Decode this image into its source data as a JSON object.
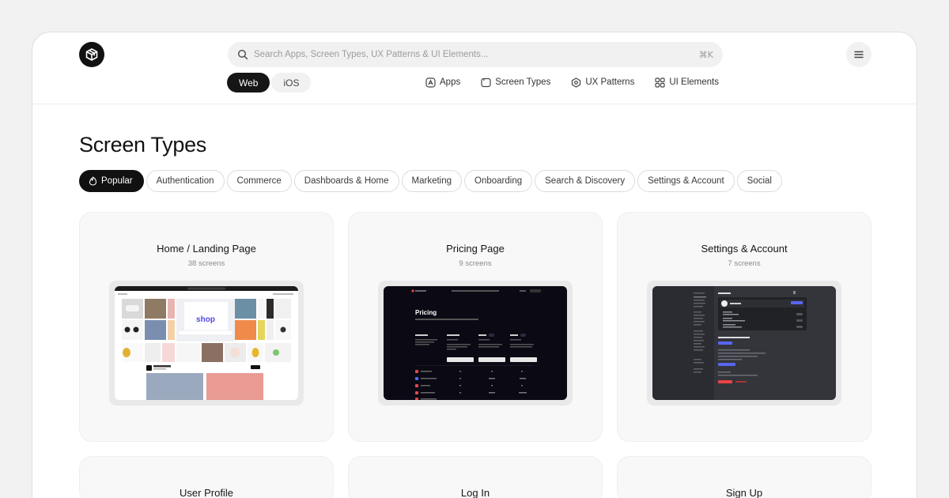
{
  "search": {
    "placeholder": "Search Apps, Screen Types, UX Patterns & UI Elements...",
    "shortcut": "⌘K"
  },
  "platform": {
    "web": "Web",
    "ios": "iOS",
    "selected": "Web"
  },
  "nav": {
    "apps": "Apps",
    "screen_types": "Screen Types",
    "ux_patterns": "UX Patterns",
    "ui_elements": "UI Elements"
  },
  "page": {
    "title": "Screen Types"
  },
  "filters": [
    "Popular",
    "Authentication",
    "Commerce",
    "Dashboards & Home",
    "Marketing",
    "Onboarding",
    "Search & Discovery",
    "Settings & Account",
    "Social"
  ],
  "active_filter": "Popular",
  "cards": [
    {
      "title": "Home / Landing Page",
      "count": "38 screens"
    },
    {
      "title": "Pricing Page",
      "count": "9 screens"
    },
    {
      "title": "Settings & Account",
      "count": "7 screens"
    },
    {
      "title": "User Profile"
    },
    {
      "title": "Log In"
    },
    {
      "title": "Sign Up"
    }
  ],
  "previews": {
    "shop_word": "shop",
    "pricing_heading": "Pricing"
  },
  "icons": {
    "logo": "cube-logo-icon",
    "search": "search-icon",
    "menu": "hamburger-menu-icon",
    "apps": "app-store-icon",
    "screen_types": "screen-icon",
    "ux_patterns": "hexagon-icon",
    "ui_elements": "grid-icon",
    "popular": "flame-icon"
  },
  "colors": {
    "accent": "#111111",
    "chip_border": "#dcdcdc",
    "card_bg": "#f8f8f8",
    "shop_blue": "#4f46e5"
  }
}
